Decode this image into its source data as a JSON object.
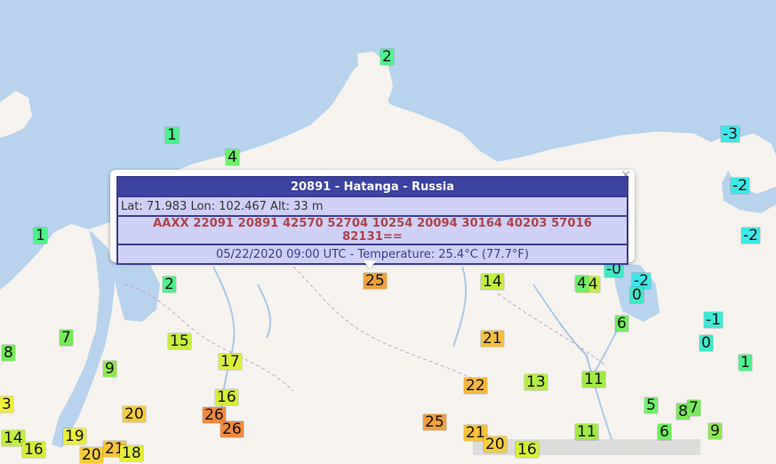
{
  "popup": {
    "title": "20891 - Hatanga - Russia",
    "coords": "Lat: 71.983 Lon: 102.467 Alt: 33 m",
    "observation": "AAXX 22091 20891 42570 52704 10254 20094 30164 40203 57016 82131==",
    "temperature": "05/22/2020 09:00 UTC - Temperature: 25.4°C (77.7°F)",
    "close_label": "×"
  },
  "colors": {
    "water": "#b7d3ee",
    "land": "#f6f3ee",
    "popup_header": "#3c42a0",
    "popup_row": "#cfd0f7",
    "observation_text": "#b0414a"
  },
  "markers": [
    {
      "label": "2",
      "color": "#4cf38a"
    },
    {
      "label": "1",
      "color": "#4cf38a"
    },
    {
      "label": "4",
      "color": "#6ef06c"
    },
    {
      "label": "1",
      "color": "#4cf38a"
    },
    {
      "label": "2",
      "color": "#4cf38a"
    },
    {
      "label": "7",
      "color": "#78e85a"
    },
    {
      "label": "8",
      "color": "#78e85a"
    },
    {
      "label": "9",
      "color": "#8ce850"
    },
    {
      "label": "15",
      "color": "#c8ee3e"
    },
    {
      "label": "17",
      "color": "#dcee3a"
    },
    {
      "label": "16",
      "color": "#d4ee3a"
    },
    {
      "label": "20",
      "color": "#f6cc3c"
    },
    {
      "label": "26",
      "color": "#ef8a3e"
    },
    {
      "label": "26",
      "color": "#ef8a3e"
    },
    {
      "label": "14",
      "color": "#c0ee40"
    },
    {
      "label": "16",
      "color": "#d4ee3a"
    },
    {
      "label": "19",
      "color": "#ecee38"
    },
    {
      "label": "20",
      "color": "#f6cc3c"
    },
    {
      "label": "21",
      "color": "#f8c03c"
    },
    {
      "label": "18",
      "color": "#e4ee38"
    },
    {
      "label": "3",
      "color": "#f0ee38"
    },
    {
      "label": "14",
      "color": "#c0ee40"
    },
    {
      "label": "25",
      "color": "#f0a03e"
    },
    {
      "label": "14",
      "color": "#c0ee40"
    },
    {
      "label": "4",
      "color": "#6ef06c"
    },
    {
      "label": "21",
      "color": "#f8c03c"
    },
    {
      "label": "22",
      "color": "#f6b63c"
    },
    {
      "label": "13",
      "color": "#b4ee42"
    },
    {
      "label": "11",
      "color": "#a0ea46"
    },
    {
      "label": "25",
      "color": "#f0a03e"
    },
    {
      "label": "21",
      "color": "#f8c03c"
    },
    {
      "label": "20",
      "color": "#f6cc3c"
    },
    {
      "label": "16",
      "color": "#d4ee3a"
    },
    {
      "label": "11",
      "color": "#a0ea46"
    },
    {
      "label": "6",
      "color": "#70ea60"
    },
    {
      "label": "5",
      "color": "#6ef06c"
    },
    {
      "label": "8",
      "color": "#78e85a"
    },
    {
      "label": "7",
      "color": "#78e85a"
    },
    {
      "label": "6",
      "color": "#70ea60"
    },
    {
      "label": "9",
      "color": "#8ce850"
    },
    {
      "label": "-3",
      "color": "#3ce8e8"
    },
    {
      "label": "-2",
      "color": "#3ce8e8"
    },
    {
      "label": "-2",
      "color": "#3ce8e8"
    },
    {
      "label": "-0",
      "color": "#3ee8c8"
    },
    {
      "label": "-2",
      "color": "#3ce8e8"
    },
    {
      "label": "0",
      "color": "#3ee8c8"
    },
    {
      "label": "-1",
      "color": "#3ee8d8"
    },
    {
      "label": "0",
      "color": "#3ee8c8"
    },
    {
      "label": "1",
      "color": "#4cf38a"
    }
  ]
}
